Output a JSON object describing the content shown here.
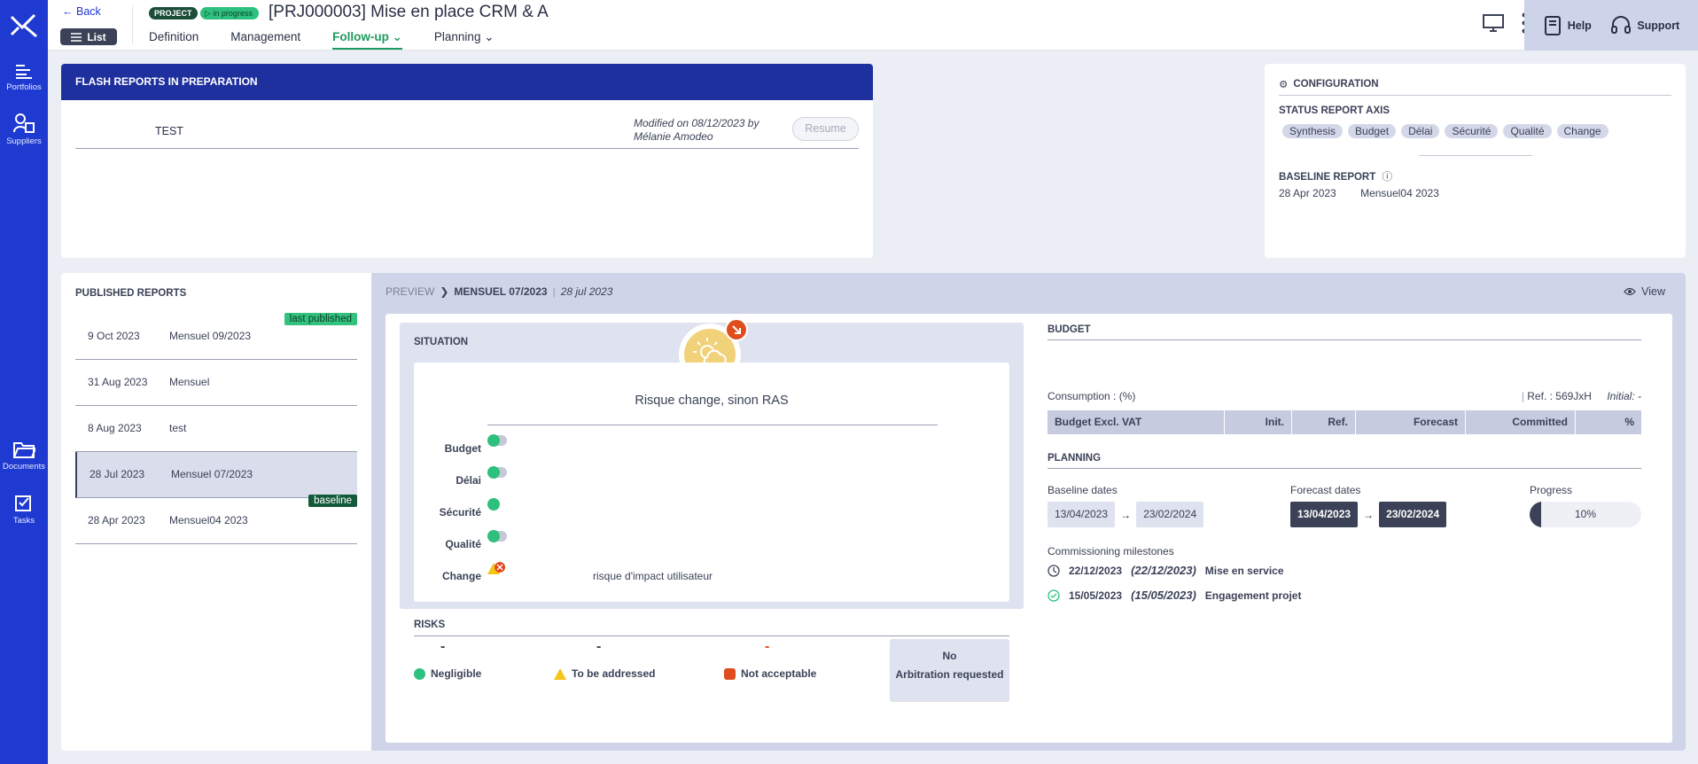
{
  "rail": {
    "items": [
      {
        "label": "Portfolios"
      },
      {
        "label": "Suppliers"
      },
      {
        "label": "Documents"
      },
      {
        "label": "Tasks"
      }
    ]
  },
  "header": {
    "back_label": "Back",
    "list_label": "List",
    "project_badge": "PROJECT",
    "status_badge": "in progress",
    "title": "[PRJ000003] Mise en place CRM & A",
    "tabs": [
      {
        "label": "Definition"
      },
      {
        "label": "Management"
      },
      {
        "label": "Follow-up"
      },
      {
        "label": "Planning"
      }
    ],
    "help_label": "Help",
    "support_label": "Support"
  },
  "flash": {
    "title": "FLASH REPORTS IN PREPARATION",
    "row": {
      "name": "TEST",
      "modified": "Modified on 08/12/2023 by Mélanie Amodeo",
      "resume_label": "Resume"
    }
  },
  "config": {
    "title": "CONFIGURATION",
    "axis_title": "STATUS REPORT AXIS",
    "axes": [
      "Synthesis",
      "Budget",
      "Délai",
      "Sécurité",
      "Qualité",
      "Change"
    ],
    "baseline_title": "BASELINE REPORT",
    "baseline_date": "28 Apr 2023",
    "baseline_name": "Mensuel04 2023"
  },
  "published": {
    "title": "PUBLISHED REPORTS",
    "reports": [
      {
        "date": "9 Oct 2023",
        "name": "Mensuel 09/2023",
        "tag": "last published"
      },
      {
        "date": "31 Aug 2023",
        "name": "Mensuel",
        "tag": ""
      },
      {
        "date": "8 Aug 2023",
        "name": "test",
        "tag": ""
      },
      {
        "date": "28 Jul 2023",
        "name": "Mensuel 07/2023",
        "tag": "baseline"
      },
      {
        "date": "28 Apr 2023",
        "name": "Mensuel04 2023",
        "tag": ""
      }
    ]
  },
  "preview": {
    "label": "PREVIEW",
    "report_name": "MENSUEL 07/2023",
    "report_date": "28 jul 2023",
    "view_label": "View",
    "situation": {
      "title": "SITUATION",
      "comment": "Risque change, sinon RAS",
      "axes": [
        {
          "label": "Budget",
          "comment": ""
        },
        {
          "label": "Délai",
          "comment": ""
        },
        {
          "label": "Sécurité",
          "comment": ""
        },
        {
          "label": "Qualité",
          "comment": ""
        },
        {
          "label": "Change",
          "comment": "risque d'impact utilisateur"
        }
      ]
    },
    "risks": {
      "title": "RISKS",
      "negligible_value": "-",
      "addressed_value": "-",
      "unacceptable_value": "-",
      "negligible_label": "Negligible",
      "addressed_label": "To be addressed",
      "unacceptable_label": "Not acceptable",
      "arbitration_line1": "No",
      "arbitration_line2": "Arbitration requested"
    },
    "budget": {
      "title": "BUDGET",
      "consumption": "Consumption : (%)",
      "ref": "Ref. : 569JxH",
      "initial": "Initial: -",
      "columns": [
        "Budget Excl. VAT",
        "Init.",
        "Ref.",
        "Forecast",
        "Committed",
        "%"
      ]
    },
    "planning": {
      "title": "PLANNING",
      "baseline_label": "Baseline dates",
      "baseline_start": "13/04/2023",
      "baseline_end": "23/02/2024",
      "forecast_label": "Forecast dates",
      "forecast_start": "13/04/2023",
      "forecast_end": "23/02/2024",
      "progress_label": "Progress",
      "progress_value": "10%",
      "progress_fraction": 0.1,
      "milestones_label": "Commissioning milestones",
      "milestones": [
        {
          "date": "22/12/2023",
          "forecast": "(22/12/2023)",
          "name": "Mise en service",
          "icon": "clock-icon"
        },
        {
          "date": "15/05/2023",
          "forecast": "(15/05/2023)",
          "name": "Engagement projet",
          "icon": "check-circle-icon"
        }
      ]
    }
  },
  "colors": {
    "brand": "#1f3ad0",
    "accent_green": "#1d9a5c",
    "risk_red": "#df4d1c",
    "warning_yellow": "#f5c518"
  }
}
